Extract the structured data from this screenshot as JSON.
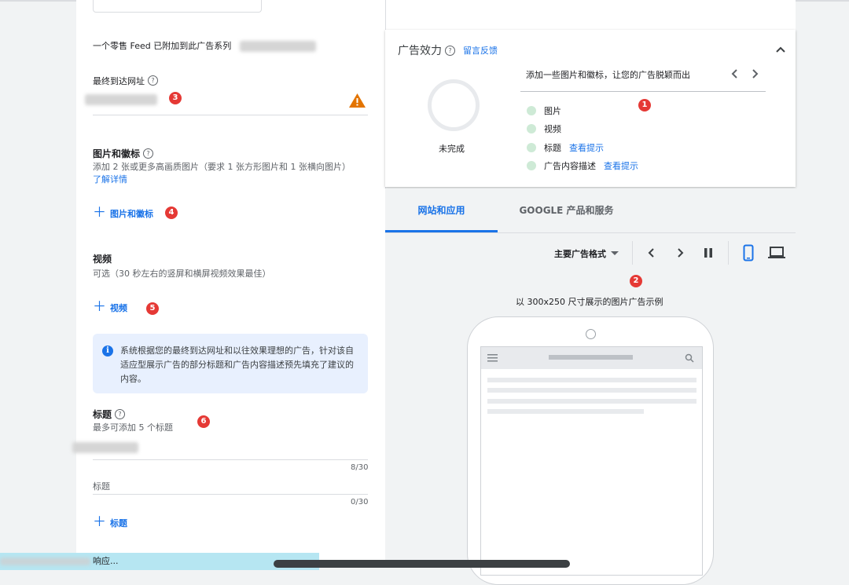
{
  "left": {
    "feed_notice": "一个零售 Feed 已附加到此广告系列",
    "final_url": {
      "label": "最终到达网址",
      "badge": "3"
    },
    "images": {
      "title": "图片和徽标",
      "desc": "添加 2 张或更多高画质图片（要求 1 张方形图片和 1 张横向图片）",
      "learn_more": "了解详情",
      "add_label": "图片和徽标",
      "badge": "4"
    },
    "video": {
      "title": "视频",
      "desc": "可选（30 秒左右的竖屏和横屏视频效果最佳）",
      "add_label": "视频",
      "badge": "5"
    },
    "info": "系统根据您的最终到达网址和以往效果理想的广告，针对该自适应型展示广告的部分标题和广告内容描述预先填充了建议的内容。",
    "headlines": {
      "title": "标题",
      "desc": "最多可添加 5 个标题",
      "badge": "6",
      "count1": "8/30",
      "placeholder": "标题",
      "count2": "0/30",
      "add_label": "标题"
    },
    "toast_text": "响应..."
  },
  "effect": {
    "title": "广告效力",
    "feedback": "留言反馈",
    "status": "未完成",
    "tip": "添加一些图片和徽标，让您的广告脱颖而出",
    "badge": "1",
    "items": [
      {
        "label": "图片",
        "link": ""
      },
      {
        "label": "视频",
        "link": ""
      },
      {
        "label": "标题",
        "link": "查看提示"
      },
      {
        "label": "广告内容描述",
        "link": "查看提示"
      }
    ]
  },
  "preview": {
    "tabs": [
      "网站和应用",
      "GOOGLE 产品和服务"
    ],
    "format": "主要广告格式",
    "badge": "2",
    "caption": "以 300x250 尺寸展示的图片广告示例"
  }
}
